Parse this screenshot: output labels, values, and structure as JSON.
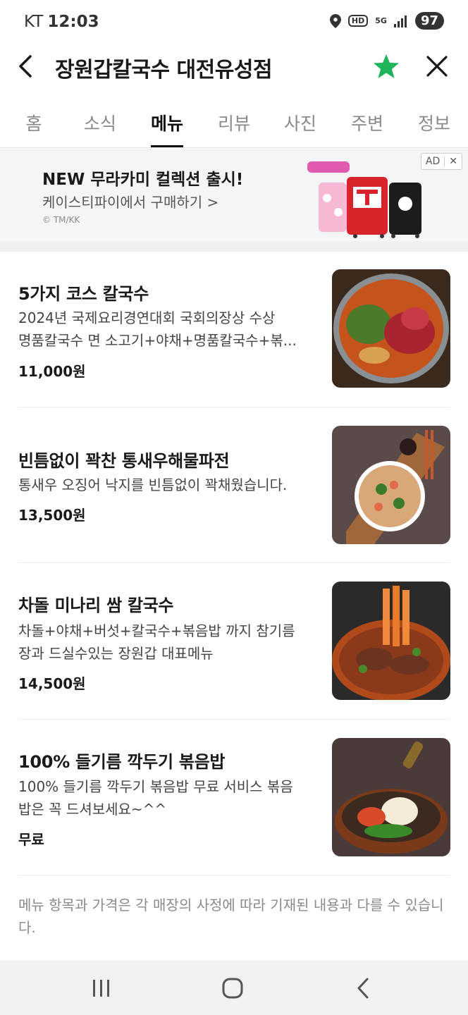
{
  "status_bar": {
    "carrier": "KT",
    "time": "12:03",
    "hd": "HD",
    "network": "5G",
    "battery": "97"
  },
  "header": {
    "title": "장원갑칼국수 대전유성점",
    "star_color": "#1fb55a"
  },
  "tabs": [
    {
      "label": "홈",
      "active": false
    },
    {
      "label": "소식",
      "active": false
    },
    {
      "label": "메뉴",
      "active": true
    },
    {
      "label": "리뷰",
      "active": false
    },
    {
      "label": "사진",
      "active": false
    },
    {
      "label": "주변",
      "active": false
    },
    {
      "label": "정보",
      "active": false
    }
  ],
  "ad": {
    "title": "NEW 무라카미 컬렉션 출시!",
    "subtitle": "케이스티파이에서 구매하기 >",
    "copyright": "© TM/KK",
    "badge": "AD",
    "close": "✕"
  },
  "menu_items": [
    {
      "name": "5가지 코스 칼국수",
      "desc_line1": "2024년 국제요리경연대회 국회의장상 수상",
      "desc_line2": "명품칼국수 면 소고기+야채+명품칼국수+볶...",
      "price": "11,000원"
    },
    {
      "name": "빈틈없이 꽉찬 통새우해물파전",
      "desc_line1": "통새우 오징어 낙지를 빈틈없이 꽉채웠습니다.",
      "desc_line2": "",
      "price": "13,500원"
    },
    {
      "name": "차돌 미나리 쌈 칼국수",
      "desc_line1": "차돌+야채+버섯+칼국수+볶음밥 까지 참기름",
      "desc_line2": "장과 드실수있는 장원갑 대표메뉴",
      "price": "14,500원"
    },
    {
      "name": "100% 들기름 깍두기 볶음밥",
      "desc_line1": "100% 들기름 깍두기 볶음밥 무료 서비스 볶음",
      "desc_line2": "밥은 꼭 드셔보세요~^^",
      "price": "무료"
    }
  ],
  "notice": "메뉴 항목과 가격은 각 매장의 사정에 따라 기재된 내용과 다를 수 있습니다."
}
